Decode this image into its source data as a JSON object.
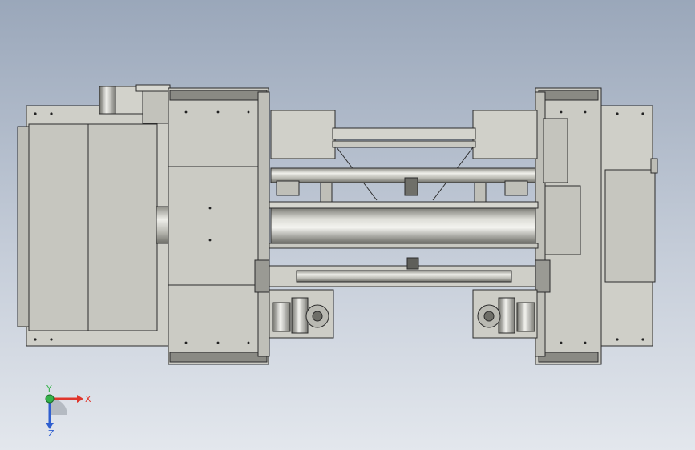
{
  "viewport": {
    "view": "top",
    "background_top": "#9aa7ba",
    "background_bottom": "#e3e7ed"
  },
  "model": {
    "body_color": "#c9c9c2",
    "edge_color": "#2b2b2b",
    "shaft_color": "#bdbdb6",
    "highlight_color": "#eeeeea"
  },
  "triad": {
    "x_label": "X",
    "y_label": "Y",
    "z_label": "Z",
    "x_color": "#e0362c",
    "y_color": "#35b24a",
    "z_color": "#2f5fd0"
  }
}
